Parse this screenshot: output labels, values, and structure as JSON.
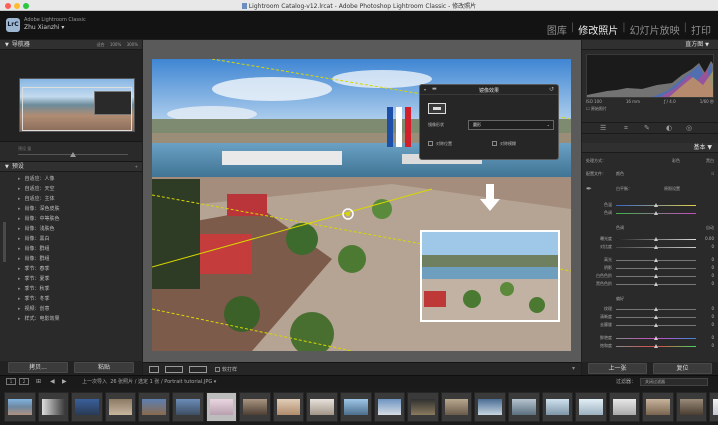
{
  "window": {
    "title": "Lightroom Catalog-v12.lrcat - Adobe Photoshop Lightroom Classic - 修改照片"
  },
  "identity": {
    "brand": "Adobe Lightroom Classic",
    "logo": "LrC",
    "user": "Zhu Xianzhi"
  },
  "modules": [
    {
      "label": "图库",
      "active": false
    },
    {
      "label": "修改照片",
      "active": true
    },
    {
      "label": "幻灯片放映",
      "active": false
    },
    {
      "label": "打印",
      "active": false
    }
  ],
  "navigator": {
    "title": "导航器",
    "zoom_options": [
      "适合",
      "100%",
      "300%"
    ]
  },
  "presets": {
    "title": "预设",
    "sub_label": "预设 量",
    "items": [
      "自适应：人像",
      "自适应：天空",
      "自适应：主体",
      "肖像：深色皮肤",
      "肖像：中等肤色",
      "肖像：浅肤色",
      "肖像：黑白",
      "肖像：群组",
      "肖像：群组",
      "季节：春季",
      "季节：夏季",
      "季节：秋季",
      "季节：冬季",
      "视频：创意",
      "样式：电影效果"
    ]
  },
  "left_footer": {
    "copy": "拷贝...",
    "paste": "粘贴"
  },
  "popup": {
    "title": "镜像效果",
    "mode_label": "镜像形状",
    "mode_value": "圆形",
    "checkbox_1": "对称位置",
    "checkbox_2": "对称模糊"
  },
  "toolbar": {
    "soft_proof": "软打样"
  },
  "histogram": {
    "title": "直方图",
    "iso": "ISO 100",
    "focal": "16 mm",
    "aperture": "ƒ / 4.0",
    "shutter": "1/60 秒",
    "original": "原始照片"
  },
  "basic": {
    "title": "基本",
    "treatment_label": "处理方式：",
    "treatment_color": "彩色",
    "treatment_bw": "黑白",
    "profile_label": "配置文件：",
    "profile_value": "颜色",
    "wb_label": "白平衡：",
    "wb_value": "原照设置",
    "temp_label": "色温",
    "tint_label": "色调",
    "tone_label": "色调",
    "auto_label": "自动",
    "exposure_label": "曝光度",
    "exposure_value": "0.00",
    "contrast_label": "对比度",
    "highlights_label": "高光",
    "shadows_label": "阴影",
    "whites_label": "白色色阶",
    "blacks_label": "黑色色阶",
    "presence_label": "偏好",
    "texture_label": "纹理",
    "clarity_label": "清晰度",
    "dehaze_label": "去朦胧",
    "vibrance_label": "鲜艳度",
    "saturation_label": "饱和度",
    "zero": "0"
  },
  "right_footer": {
    "previous": "上一张",
    "reset": "复位"
  },
  "filmstrip_bar": {
    "page1": "1",
    "page2": "2",
    "source": "上一次导入",
    "count": "26 张照片 / 选定 1 张 / Portrait tutorial.JPG",
    "filter_label": "过滤器：",
    "filter_value": "关闭过滤器"
  },
  "colors": {
    "accent": "#cdb100",
    "panel_bg": "#2a2a2a",
    "module_active": "#ececec"
  }
}
